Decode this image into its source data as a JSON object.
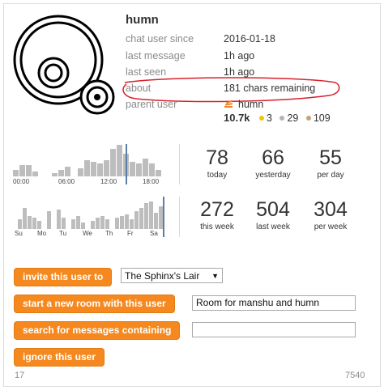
{
  "profile": {
    "username": "humn",
    "fields": [
      {
        "label": "chat user since",
        "value": "2016-01-18"
      },
      {
        "label": "last message",
        "value": "1h ago"
      },
      {
        "label": "last seen",
        "value": "1h ago"
      },
      {
        "label": "about",
        "value": "181 chars remaining"
      },
      {
        "label": "parent user",
        "value": "humn"
      }
    ],
    "reputation": "10.7k",
    "badges": {
      "gold": "3",
      "silver": "29",
      "bronze": "109"
    }
  },
  "activity": {
    "hourly_ticks": [
      "00:00",
      "06:00",
      "12:00",
      "18:00"
    ],
    "weekday_ticks": [
      "Su",
      "Mo",
      "Tu",
      "We",
      "Th",
      "Fr",
      "Sa"
    ],
    "stats_row1": [
      {
        "value": "78",
        "caption": "today"
      },
      {
        "value": "66",
        "caption": "yesterday"
      },
      {
        "value": "55",
        "caption": "per day"
      }
    ],
    "stats_row2": [
      {
        "value": "272",
        "caption": "this week"
      },
      {
        "value": "504",
        "caption": "last week"
      },
      {
        "value": "304",
        "caption": "per week"
      }
    ],
    "colors": {
      "bar": "#bdbdbd",
      "marker": "#5b7fa6"
    }
  },
  "actions": {
    "invite_label": "invite this user to",
    "room_select_value": "The Sphinx's Lair",
    "new_room_label": "start a new room with this user",
    "new_room_value": "Room for manshu and humn",
    "search_label": "search for messages containing",
    "search_value": "",
    "ignore_label": "ignore this user",
    "accent": "#f5891f"
  },
  "footer": {
    "left": "17",
    "right": "7540"
  }
}
